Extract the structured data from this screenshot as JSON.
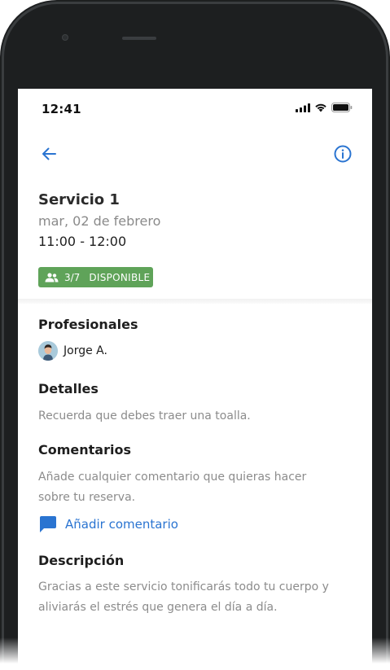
{
  "status_bar": {
    "time": "12:41"
  },
  "nav": {
    "back_icon": "arrow-left-icon",
    "info_icon": "info-circle-icon"
  },
  "service": {
    "title": "Servicio 1",
    "date": "mar, 02 de febrero",
    "hours": "11:00 - 12:00",
    "capacity": "3/7",
    "availability": "DISPONIBLE"
  },
  "professionals": {
    "heading": "Profesionales",
    "items": [
      {
        "name": "Jorge A."
      }
    ]
  },
  "details": {
    "heading": "Detalles",
    "text": "Recuerda que debes traer una toalla."
  },
  "comments": {
    "heading": "Comentarios",
    "text": "Añade cualquier comentario que quieras hacer sobre tu reserva.",
    "add_label": "Añadir comentario"
  },
  "description": {
    "heading": "Descripción",
    "text": "Gracias a este servicio tonificarás todo tu cuerpo y aliviarás el estrés que genera el día a día."
  },
  "colors": {
    "accent": "#2a74d1",
    "badge": "#5fa359",
    "phone_frame": "#1d1f20"
  }
}
